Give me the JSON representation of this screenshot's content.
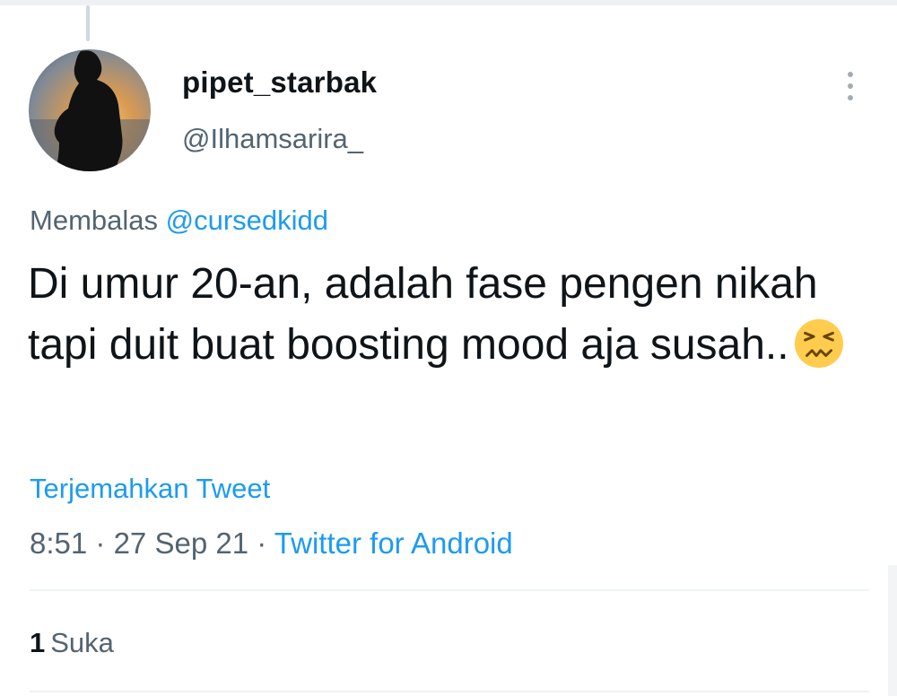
{
  "user": {
    "display_name": "pipet_starbak",
    "handle": "@Ilhamsarira_"
  },
  "reply": {
    "prefix": "Membalas",
    "mention": "@cursedkidd"
  },
  "tweet": {
    "text": "Di umur 20-an, adalah fase pengen nikah tapi duit buat boosting mood aja susah..",
    "emoji": "confounded-face-emoji"
  },
  "translate_label": "Terjemahkan Tweet",
  "meta": {
    "time": "8:51",
    "separator": "·",
    "date": "27 Sep 21",
    "source": "Twitter for Android"
  },
  "stats": {
    "likes_count": "1",
    "likes_label": "Suka"
  },
  "colors": {
    "accent": "#1d9bf0",
    "secondary_text": "#536471",
    "primary_text": "#0f1419",
    "emoji_yellow": "#ffcc4d"
  },
  "icons": {
    "more": "vertical-ellipsis-icon"
  }
}
